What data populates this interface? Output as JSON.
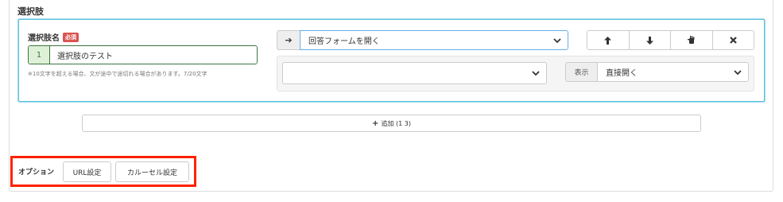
{
  "section": {
    "title": "選択肢"
  },
  "choice": {
    "label": "選択肢名",
    "required_badge": "必須",
    "index": "1",
    "name_value": "選択肢のテスト",
    "help_text": "※10文字を超える場合、文が途中で途切れる場合があります。7/20文字",
    "action_arrow": "➔",
    "action_value": "回答フォームを開く",
    "target_value": "",
    "display_label": "表示",
    "display_value": "直接開く",
    "move_buttons": [
      "🡅",
      "🡇",
      "✋",
      "✖"
    ]
  },
  "add_button": {
    "plus": "+",
    "label": "追加 (1 3)"
  },
  "options": {
    "label": "オプション",
    "url_button": "URL設定",
    "carousel_button": "カルーセル設定"
  },
  "colors": {
    "accent_border": "#5bc0de",
    "success": "#3c763d",
    "required": "#d9534f",
    "highlight": "#ff2200"
  }
}
